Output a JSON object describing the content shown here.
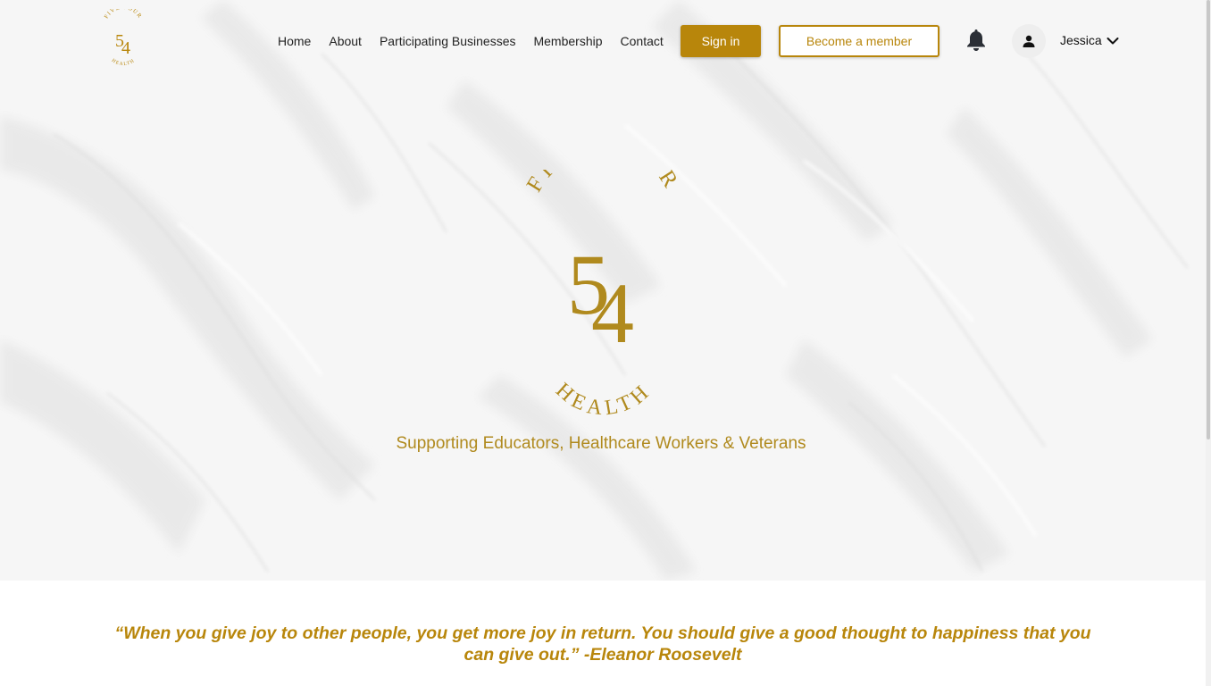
{
  "brand": {
    "logo_top_text": "FIVE FOUR",
    "logo_number_1": "5",
    "logo_number_2": "4",
    "logo_bottom_text": "HEALTH",
    "gold": "#b8860b"
  },
  "nav": {
    "items": [
      "Home",
      "About",
      "Participating Businesses",
      "Membership",
      "Contact"
    ],
    "signin_label": "Sign in",
    "become_member_label": "Become a member",
    "user_name": "Jessica",
    "icons": {
      "notifications": "bell-icon",
      "user": "user-icon",
      "dropdown": "chevron-down-icon"
    }
  },
  "hero": {
    "tagline": "Supporting Educators, Healthcare Workers & Veterans"
  },
  "quote": {
    "text": "“When you give joy to other people, you get more joy in return. You should give a good thought to happiness that you can give out.” -Eleanor Roosevelt"
  }
}
